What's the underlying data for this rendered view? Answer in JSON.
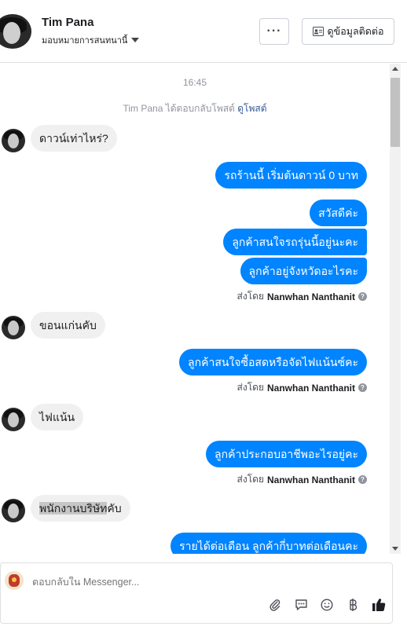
{
  "header": {
    "name": "Tim Pana",
    "assign_label": "มอบหมายการสนทนานี้",
    "more_label": "···",
    "contact_label": "ดูข้อมูลติดต่อ"
  },
  "conversation": {
    "timestamp": "16:45",
    "reply_note_text": "Tim Pana ได้ตอบกลับโพสต์",
    "reply_note_link": "ดูโพสต์",
    "sent_by_prefix": "ส่งโดย",
    "agent_name": "Nanwhan Nanthanit",
    "messages": {
      "m1": "ดาวน์เท่าไหร่?",
      "m2": "รถร้านนี้ เริ่มต้นดาวน์ 0 บาท",
      "m3": "สวัสดีค่ะ",
      "m4": "ลูกค้าสนใจรถรุ่นนี้อยู่นะคะ",
      "m5": "ลูกค้าอยู่จังหวัดอะไรคะ",
      "m6": "ขอนแก่นคับ",
      "m7": "ลูกค้าสนใจซื้อสดหรือจัดไฟแน้นซ์คะ",
      "m8": "ไฟแน้น",
      "m9": "ลูกค้าประกอบอาชีพอะไรอยู่คะ",
      "m10_highlight": "พนักงานบริษัท",
      "m10_rest": "คับ",
      "m11": "รายได้ต่อเดือน ลูกค้ากี่บาทต่อเดือนคะ"
    }
  },
  "composer": {
    "placeholder": "ตอบกลับใน Messenger..."
  },
  "icons": {
    "attach": "paperclip-icon",
    "sticker": "chat-bubble-icon",
    "emoji": "emoji-icon",
    "currency": "baht-icon",
    "like": "thumbs-up-icon"
  },
  "colors": {
    "outgoing_bubble": "#0084ff",
    "incoming_bubble": "#f1f0f0",
    "link": "#365899"
  }
}
